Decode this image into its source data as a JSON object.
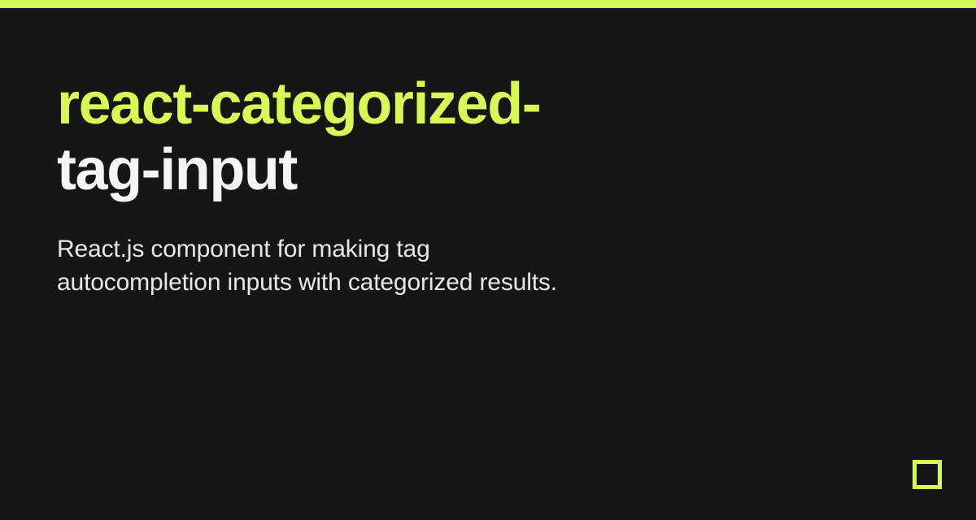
{
  "title": {
    "highlight": "react-categorized-",
    "rest": "tag-input"
  },
  "description": "React.js component for making tag autocompletion inputs with categorized results.",
  "colors": {
    "accent": "#d8f85a",
    "background": "#161616",
    "text": "#f5f5f5"
  }
}
